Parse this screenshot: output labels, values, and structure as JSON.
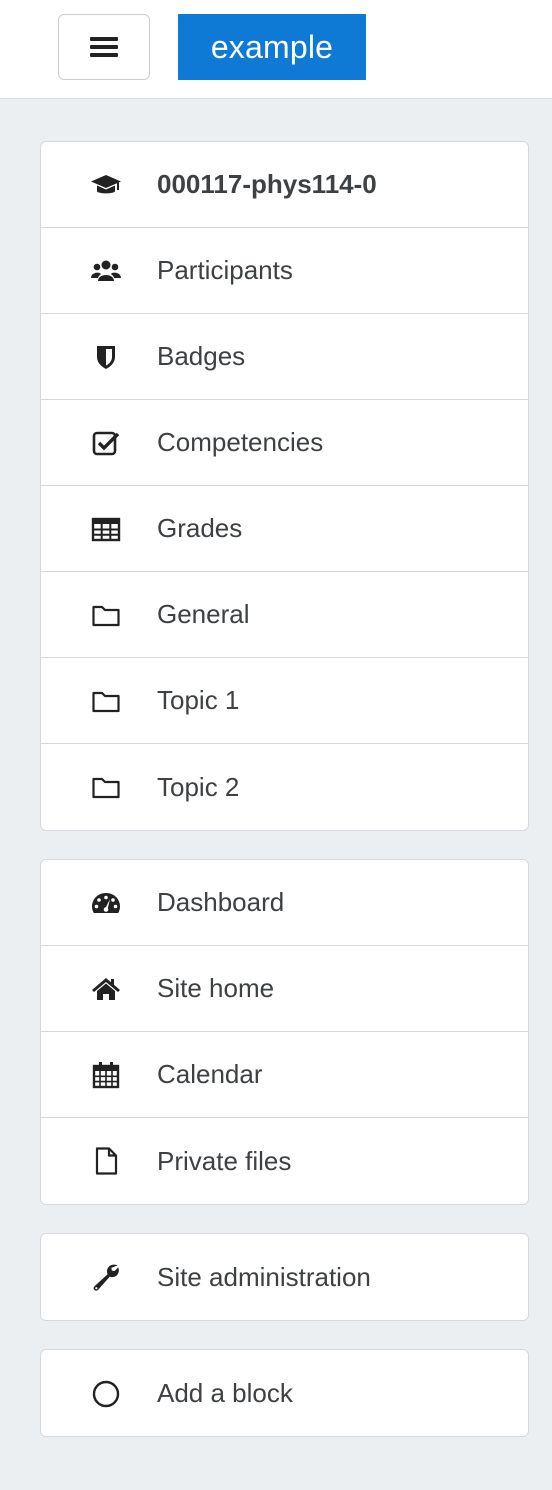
{
  "header": {
    "brand": "example",
    "menu_icon": "hamburger-icon"
  },
  "course_nav": [
    {
      "label": "000117-phys114-0",
      "icon": "graduation-cap-icon",
      "bold": true
    },
    {
      "label": "Participants",
      "icon": "users-icon"
    },
    {
      "label": "Badges",
      "icon": "shield-icon"
    },
    {
      "label": "Competencies",
      "icon": "check-square-icon"
    },
    {
      "label": "Grades",
      "icon": "table-icon"
    },
    {
      "label": "General",
      "icon": "folder-icon"
    },
    {
      "label": "Topic 1",
      "icon": "folder-icon"
    },
    {
      "label": "Topic 2",
      "icon": "folder-icon"
    }
  ],
  "site_nav": [
    {
      "label": "Dashboard",
      "icon": "dashboard-icon"
    },
    {
      "label": "Site home",
      "icon": "home-icon"
    },
    {
      "label": "Calendar",
      "icon": "calendar-icon"
    },
    {
      "label": "Private files",
      "icon": "file-icon"
    }
  ],
  "admin_nav": [
    {
      "label": "Site administration",
      "icon": "wrench-icon"
    }
  ],
  "block_nav": [
    {
      "label": "Add a block",
      "icon": "circle-icon"
    }
  ],
  "colors": {
    "brand_bg": "#0f7ad5",
    "page_bg": "#eceff1",
    "text": "#3e4143"
  }
}
